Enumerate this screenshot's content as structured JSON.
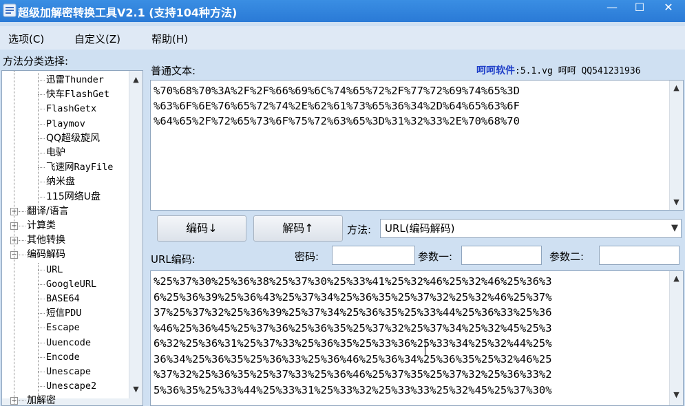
{
  "window": {
    "title": "超级加解密转换工具V2.1 (支持104种方法)",
    "minimize": "—",
    "maximize": "☐",
    "close": "✕"
  },
  "menu": [
    "选项(C)",
    "自定义(Z)",
    "帮助(H)"
  ],
  "left_panel": {
    "title": "方法分类选择:",
    "tree": [
      {
        "label": "迅雷Thunder",
        "level": 2
      },
      {
        "label": "快车FlashGet",
        "level": 2
      },
      {
        "label": "FlashGetx",
        "level": 2
      },
      {
        "label": "Playmov",
        "level": 2
      },
      {
        "label": "QQ超级旋风",
        "level": 2
      },
      {
        "label": "电驴",
        "level": 2
      },
      {
        "label": "飞速网RayFile",
        "level": 2
      },
      {
        "label": "纳米盘",
        "level": 2
      },
      {
        "label": "115网络U盘",
        "level": 2
      },
      {
        "label": "翻译/语言",
        "level": 1,
        "expander": "+"
      },
      {
        "label": "计算类",
        "level": 1,
        "expander": "+"
      },
      {
        "label": "其他转换",
        "level": 1,
        "expander": "+"
      },
      {
        "label": "编码解码",
        "level": 1,
        "expander": "−"
      },
      {
        "label": "URL",
        "level": 2
      },
      {
        "label": "GoogleURL",
        "level": 2
      },
      {
        "label": "BASE64",
        "level": 2
      },
      {
        "label": "短信PDU",
        "level": 2
      },
      {
        "label": "Escape",
        "level": 2
      },
      {
        "label": "Uuencode",
        "level": 2
      },
      {
        "label": "Encode",
        "level": 2
      },
      {
        "label": "Unescape",
        "level": 2
      },
      {
        "label": "Unescape2",
        "level": 2
      },
      {
        "label": "加解密",
        "level": 1,
        "expander": "+"
      }
    ]
  },
  "plain": {
    "label": "普通文本:",
    "brand": "呵呵软件",
    "brand_extra": ":5.1.vg  呵呵 QQ541231936",
    "lines": [
      "%70%68%70%3A%2F%2F%66%69%6C%74%65%72%2F%77%72%69%74%65%3D",
      "%63%6F%6E%76%65%72%74%2E%62%61%73%65%36%34%2D%64%65%63%6F",
      "%64%65%2F%72%65%73%6F%75%72%63%65%3D%31%32%33%2E%70%68%70"
    ]
  },
  "controls": {
    "encode_button": "编码↓",
    "decode_button": "解码↑",
    "method_label": "方法:",
    "method_value": "URL(编码解码)",
    "password_label": "密码:",
    "param1_label": "参数一:",
    "param2_label": "参数二:"
  },
  "encoded": {
    "label": "URL编码:",
    "lines": [
      "%25%37%30%25%36%38%25%37%30%25%33%41%25%32%46%25%32%46%25%36%3",
      "6%25%36%39%25%36%43%25%37%34%25%36%35%25%37%32%25%32%46%25%37%",
      "37%25%37%32%25%36%39%25%37%34%25%36%35%25%33%44%25%36%33%25%36",
      "%46%25%36%45%25%37%36%25%36%35%25%37%32%25%37%34%25%32%45%25%3",
      "6%32%25%36%31%25%37%33%25%36%35%25%33%36%25%33%34%25%32%44%25%",
      "36%34%25%36%35%25%36%33%25%36%46%25%36%34%25%36%35%25%32%46%25",
      "%37%32%25%36%35%25%37%33%25%36%46%25%37%35%25%37%32%25%36%33%2",
      "5%36%35%25%33%44%25%33%31%25%33%32%25%33%33%25%32%45%25%37%30%"
    ]
  },
  "colors": {
    "titlebar": "#2a7ad6",
    "window_bg": "#cfe0f2",
    "brand": "#1e3ec8"
  }
}
